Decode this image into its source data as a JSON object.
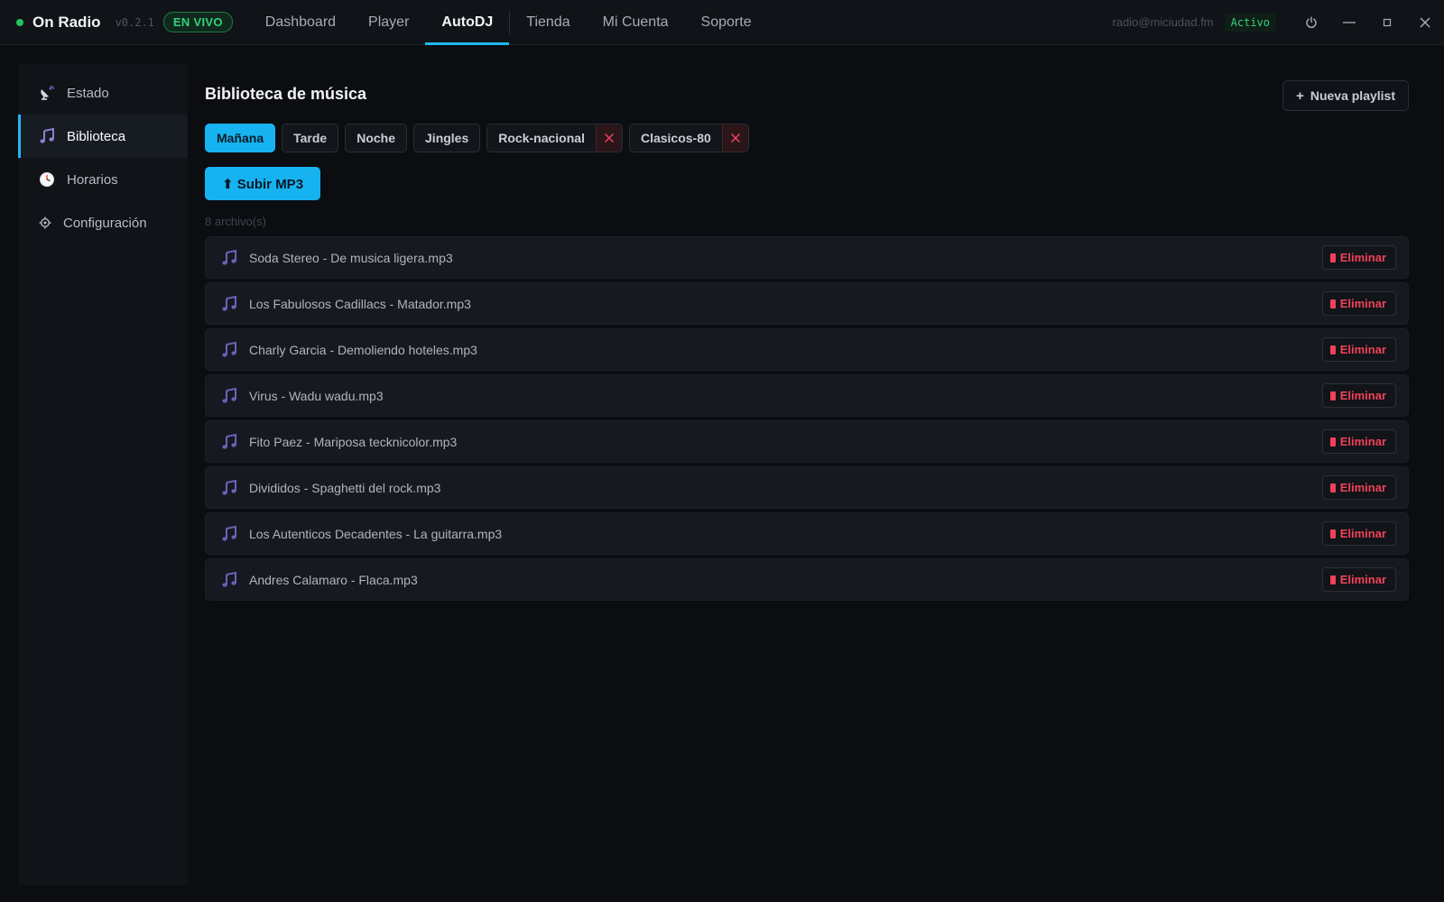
{
  "app": {
    "name": "On Radio",
    "version": "v0.2.1",
    "live_badge": "EN VIVO"
  },
  "nav": {
    "tabs": [
      "Dashboard",
      "Player",
      "AutoDJ",
      "Tienda",
      "Mi Cuenta",
      "Soporte"
    ],
    "active": "AutoDJ"
  },
  "account": {
    "email": "radio@miciudad.fm",
    "status": "Activo"
  },
  "sidebar": {
    "items": [
      {
        "label": "Estado",
        "icon": "radio-icon"
      },
      {
        "label": "Biblioteca",
        "icon": "music-note-icon"
      },
      {
        "label": "Horarios",
        "icon": "clock-icon"
      },
      {
        "label": "Configuración",
        "icon": "gear-icon"
      }
    ],
    "active": "Biblioteca"
  },
  "library": {
    "title": "Biblioteca de música",
    "new_playlist_label": "Nueva playlist",
    "playlists": [
      {
        "label": "Mañana",
        "closable": false
      },
      {
        "label": "Tarde",
        "closable": false
      },
      {
        "label": "Noche",
        "closable": false
      },
      {
        "label": "Jingles",
        "closable": false
      },
      {
        "label": "Rock-nacional",
        "closable": true
      },
      {
        "label": "Clasicos-80",
        "closable": true
      }
    ],
    "active_playlist": "Mañana",
    "upload_label": "⬆ Subir MP3",
    "file_count": "8 archivo(s)",
    "delete_label": "Eliminar",
    "files": [
      "Soda Stereo - De musica ligera.mp3",
      "Los Fabulosos Cadillacs - Matador.mp3",
      "Charly Garcia - Demoliendo hoteles.mp3",
      "Virus - Wadu wadu.mp3",
      "Fito Paez - Mariposa tecknicolor.mp3",
      "Divididos - Spaghetti del rock.mp3",
      "Los Autenticos Decadentes - La guitarra.mp3",
      "Andres Calamaro - Flaca.mp3"
    ]
  },
  "colors": {
    "accent": "#16b3f0",
    "live_green": "#22c55e",
    "danger": "#f0425a",
    "music_icon": "#6f5fb8"
  }
}
